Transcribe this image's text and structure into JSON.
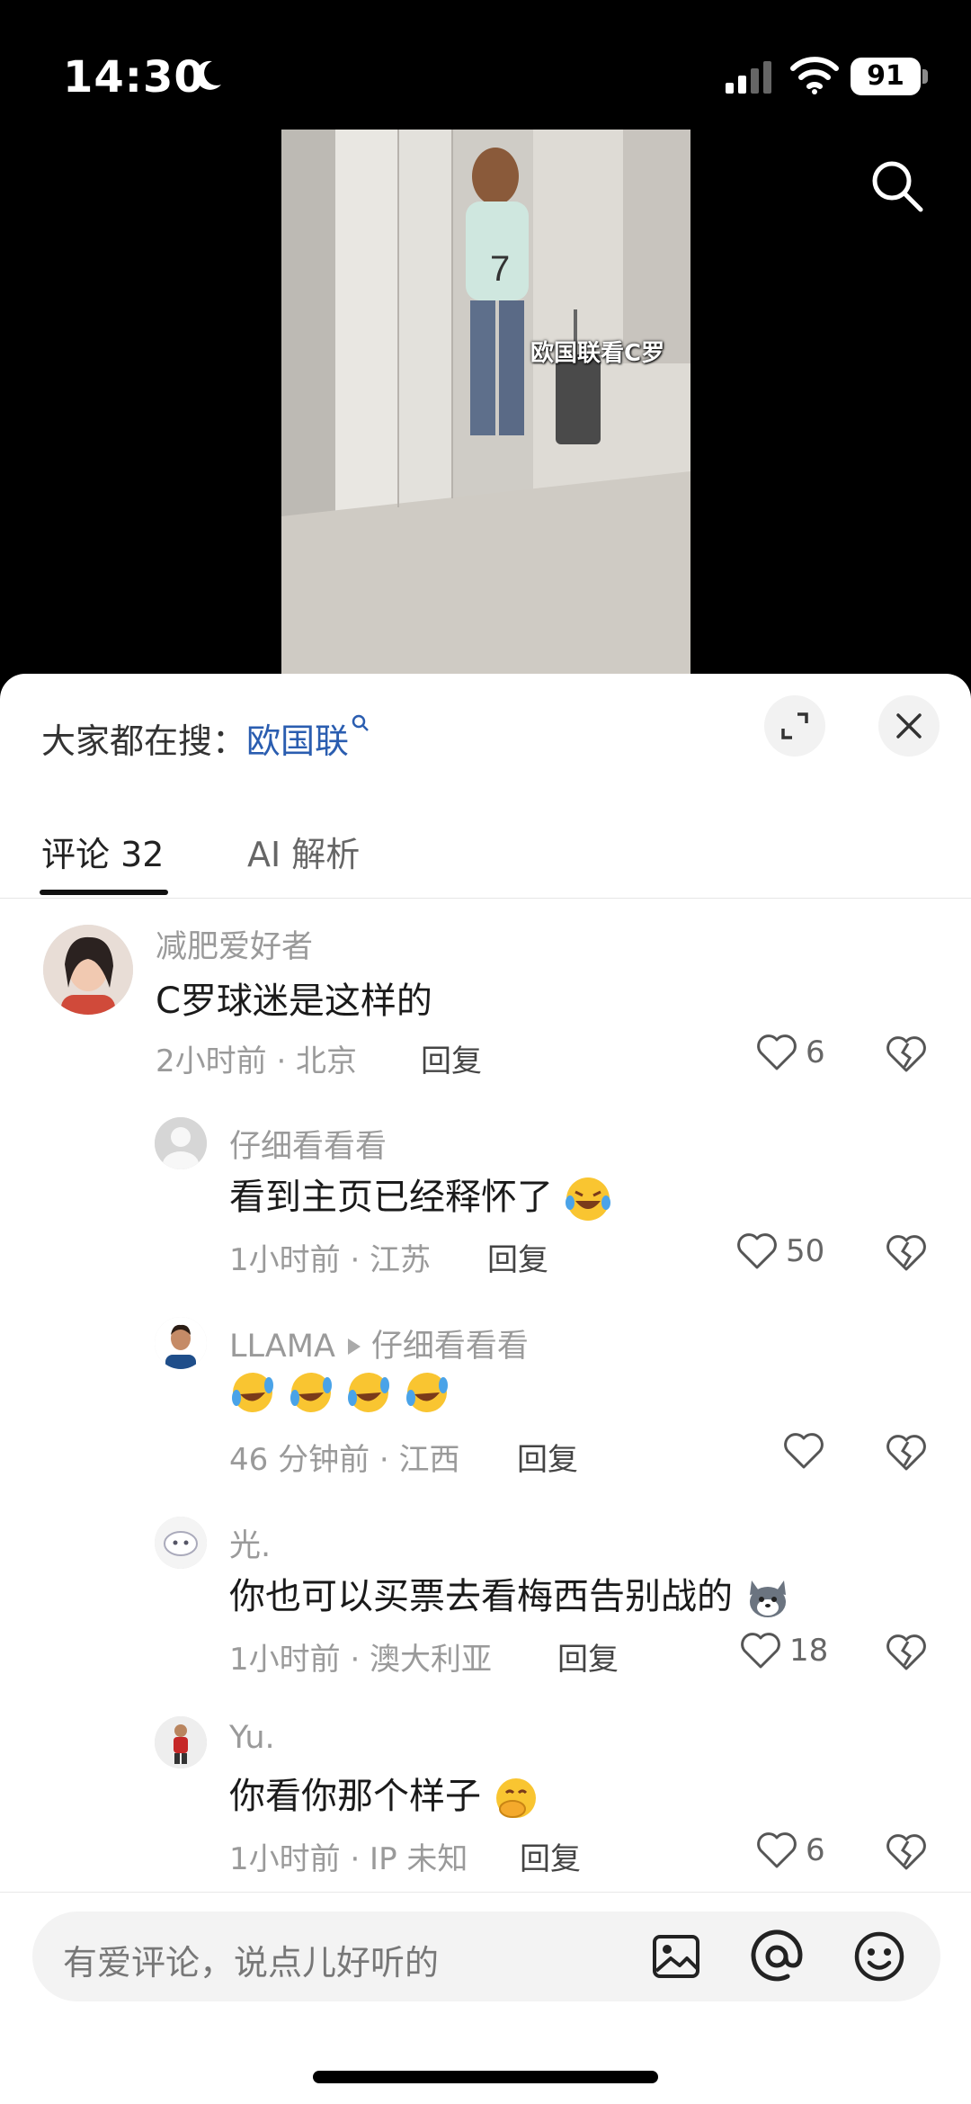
{
  "status": {
    "time": "14:30",
    "battery": "91"
  },
  "video": {
    "caption": "欧国联看C罗"
  },
  "sheet": {
    "trending_label": "大家都在搜：",
    "trending_keyword": "欧国联",
    "tabs": [
      {
        "label": "评论 32"
      },
      {
        "label": "AI 解析"
      }
    ],
    "comments": [
      {
        "user": "减肥爱好者",
        "text": "C罗球迷是这样的",
        "time_loc": "2小时前 · 北京",
        "reply": "回复",
        "likes": "6"
      },
      {
        "user": "仔细看看看",
        "text": "看到主页已经释怀了",
        "time_loc": "1小时前 · 江苏",
        "reply": "回复",
        "likes": "50"
      },
      {
        "user": "LLAMA",
        "reply_to": "仔细看看看",
        "time_loc": "46 分钟前 · 江西",
        "reply": "回复",
        "likes": ""
      },
      {
        "user": "光.",
        "text": "你也可以买票去看梅西告别战的",
        "time_loc": "1小时前 · 澳大利亚",
        "reply": "回复",
        "likes": "18"
      },
      {
        "user": "Yu.",
        "text": "你看你那个样子",
        "time_loc": "1小时前 · IP 未知",
        "reply": "回复",
        "likes": "6"
      }
    ],
    "input_placeholder": "有爱评论，说点儿好听的"
  },
  "icons": [
    "moon-icon",
    "signal-icon",
    "wifi-icon",
    "battery-icon",
    "search-icon",
    "expand-icon",
    "close-icon",
    "heart-icon",
    "broken-heart-icon",
    "image-icon",
    "at-icon",
    "emoji-icon"
  ],
  "colors": {
    "accent_link": "#2a5db0",
    "sheet_bg": "#ffffff",
    "meta_gray": "#9a9a9a"
  }
}
